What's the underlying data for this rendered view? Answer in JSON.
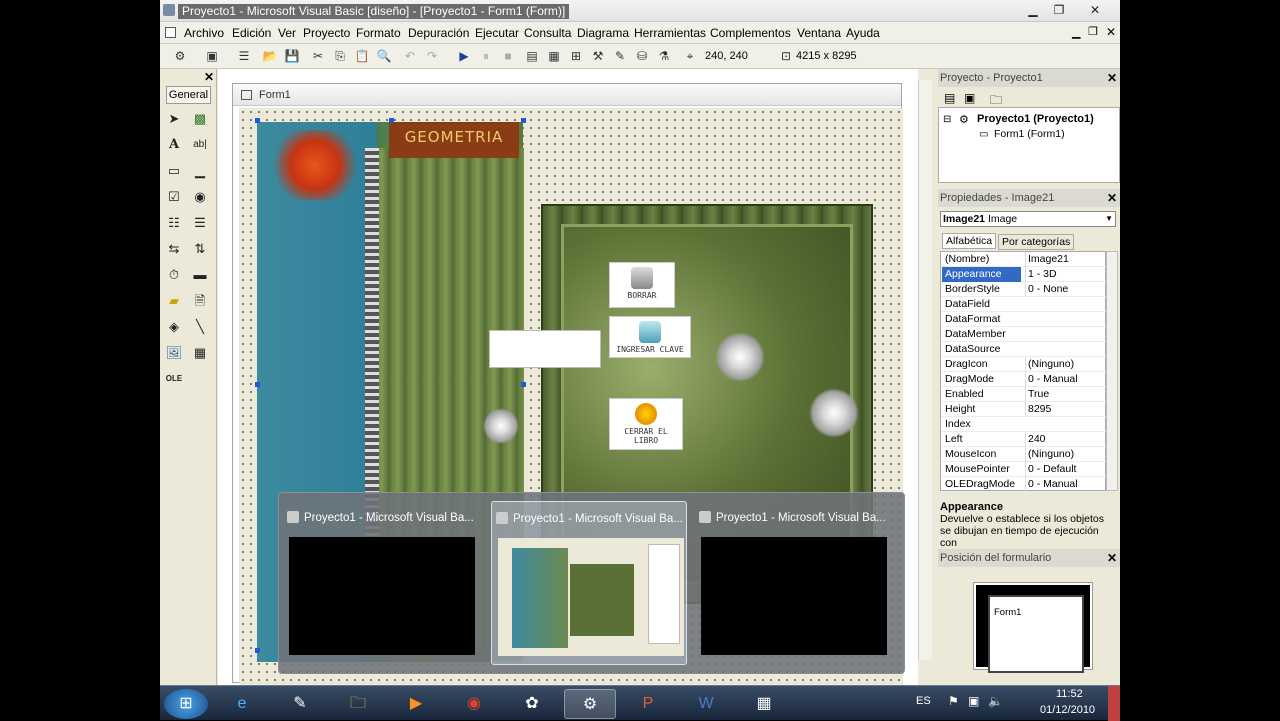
{
  "window": {
    "title": "Proyecto1 - Microsoft Visual Basic [diseño] - [Proyecto1 - Form1 (Form)]"
  },
  "menu": [
    "Archivo",
    "Edición",
    "Ver",
    "Proyecto",
    "Formato",
    "Depuración",
    "Ejecutar",
    "Consulta",
    "Diagrama",
    "Herramientas",
    "Complementos",
    "Ventana",
    "Ayuda"
  ],
  "toolbar": {
    "position_text": "240, 240",
    "size_text": "4215 x 8295"
  },
  "toolbox": {
    "header": "General",
    "tools": [
      "pointer-icon",
      "picturebox-icon",
      "label-icon",
      "textbox-icon",
      "frame-icon",
      "commandbutton-icon",
      "checkbox-icon",
      "optionbutton-icon",
      "combobox-icon",
      "listbox-icon",
      "hscrollbar-icon",
      "vscrollbar-icon",
      "timer-icon",
      "drivelistbox-icon",
      "dirlistbox-icon",
      "filelistbox-icon",
      "shape-icon",
      "line-icon",
      "image-icon",
      "data-icon",
      "ole-icon"
    ]
  },
  "form": {
    "caption": "Form1",
    "banner_text": "GEOMETRIA",
    "buttons": {
      "borrar": "BORRAR",
      "ingresar": "INGRESAR CLAVE",
      "cerrar": "CERRAR EL LIBRO"
    }
  },
  "project_panel": {
    "title": "Proyecto - Proyecto1",
    "root": "Proyecto1 (Proyecto1)",
    "child": "Form1 (Form1)"
  },
  "properties_panel": {
    "title": "Propiedades - Image21",
    "object_name": "Image21",
    "object_type": "Image",
    "tabs": [
      "Alfabética",
      "Por categorías"
    ],
    "rows": [
      {
        "k": "(Nombre)",
        "v": "Image21"
      },
      {
        "k": "Appearance",
        "v": "1 - 3D"
      },
      {
        "k": "BorderStyle",
        "v": "0 - None"
      },
      {
        "k": "DataField",
        "v": ""
      },
      {
        "k": "DataFormat",
        "v": ""
      },
      {
        "k": "DataMember",
        "v": ""
      },
      {
        "k": "DataSource",
        "v": ""
      },
      {
        "k": "DragIcon",
        "v": "(Ninguno)"
      },
      {
        "k": "DragMode",
        "v": "0 - Manual"
      },
      {
        "k": "Enabled",
        "v": "True"
      },
      {
        "k": "Height",
        "v": "8295"
      },
      {
        "k": "Index",
        "v": ""
      },
      {
        "k": "Left",
        "v": "240"
      },
      {
        "k": "MouseIcon",
        "v": "(Ninguno)"
      },
      {
        "k": "MousePointer",
        "v": "0 - Default"
      },
      {
        "k": "OLEDragMode",
        "v": "0 - Manual"
      }
    ],
    "desc_title": "Appearance",
    "desc_text": "Devuelve o establece si los objetos se dibujan en tiempo de ejecución con"
  },
  "position_panel": {
    "title": "Posición del formulario",
    "form_label": "Form1"
  },
  "switcher": {
    "items": [
      "Proyecto1 - Microsoft Visual Ba...",
      "Proyecto1 - Microsoft Visual Ba...",
      "Proyecto1 - Microsoft Visual Ba..."
    ]
  },
  "taskbar": {
    "lang": "ES",
    "time": "11:52",
    "date": "01/12/2010"
  }
}
